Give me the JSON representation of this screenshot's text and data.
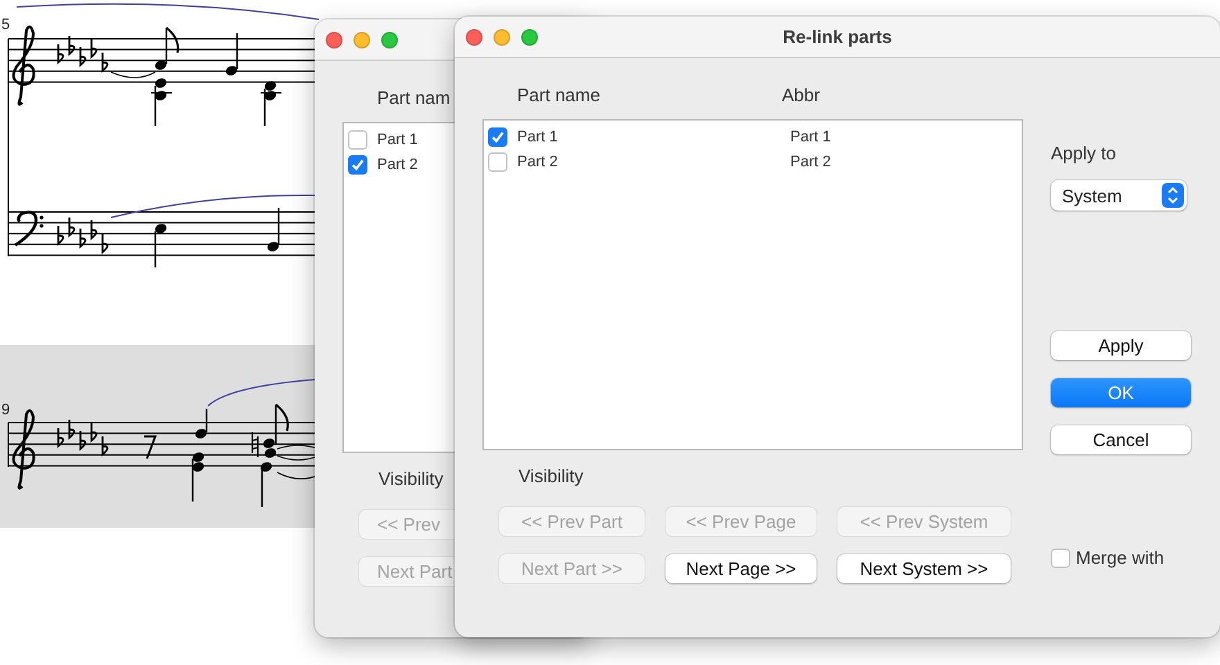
{
  "score": {
    "systems": [
      {
        "number": "5",
        "kind": "grand",
        "highlighted": false
      },
      {
        "number": "9",
        "kind": "treble",
        "highlighted": true
      }
    ]
  },
  "back_window": {
    "column_1": "Part nam",
    "parts": [
      {
        "name": "Part 1",
        "checked": false
      },
      {
        "name": "Part 2",
        "checked": true
      }
    ],
    "visibility_label": "Visibility",
    "nav_buttons": [
      {
        "label": "<< Prev",
        "disabled": true
      },
      {
        "label": "Next Part",
        "disabled": true
      }
    ]
  },
  "window": {
    "title": "Re-link parts",
    "columns": [
      "Part name",
      "Abbr"
    ],
    "parts": [
      {
        "name": "Part 1",
        "abbr": "Part 1",
        "checked": true
      },
      {
        "name": "Part 2",
        "abbr": "Part 2",
        "checked": false
      }
    ],
    "visibility_label": "Visibility",
    "nav_buttons": [
      {
        "label": "<< Prev Part",
        "disabled": true
      },
      {
        "label": "<< Prev Page",
        "disabled": true
      },
      {
        "label": "<< Prev System",
        "disabled": true
      },
      {
        "label": "Next Part >>",
        "disabled": true
      },
      {
        "label": "Next Page >>",
        "disabled": false
      },
      {
        "label": "Next System >>",
        "disabled": false
      }
    ],
    "apply_to": {
      "label": "Apply to",
      "value": "System"
    },
    "actions": [
      {
        "label": "Apply",
        "kind": "normal"
      },
      {
        "label": "OK",
        "kind": "primary"
      },
      {
        "label": "Cancel",
        "kind": "normal"
      }
    ],
    "merge": {
      "label": "Merge with",
      "checked": false
    }
  }
}
